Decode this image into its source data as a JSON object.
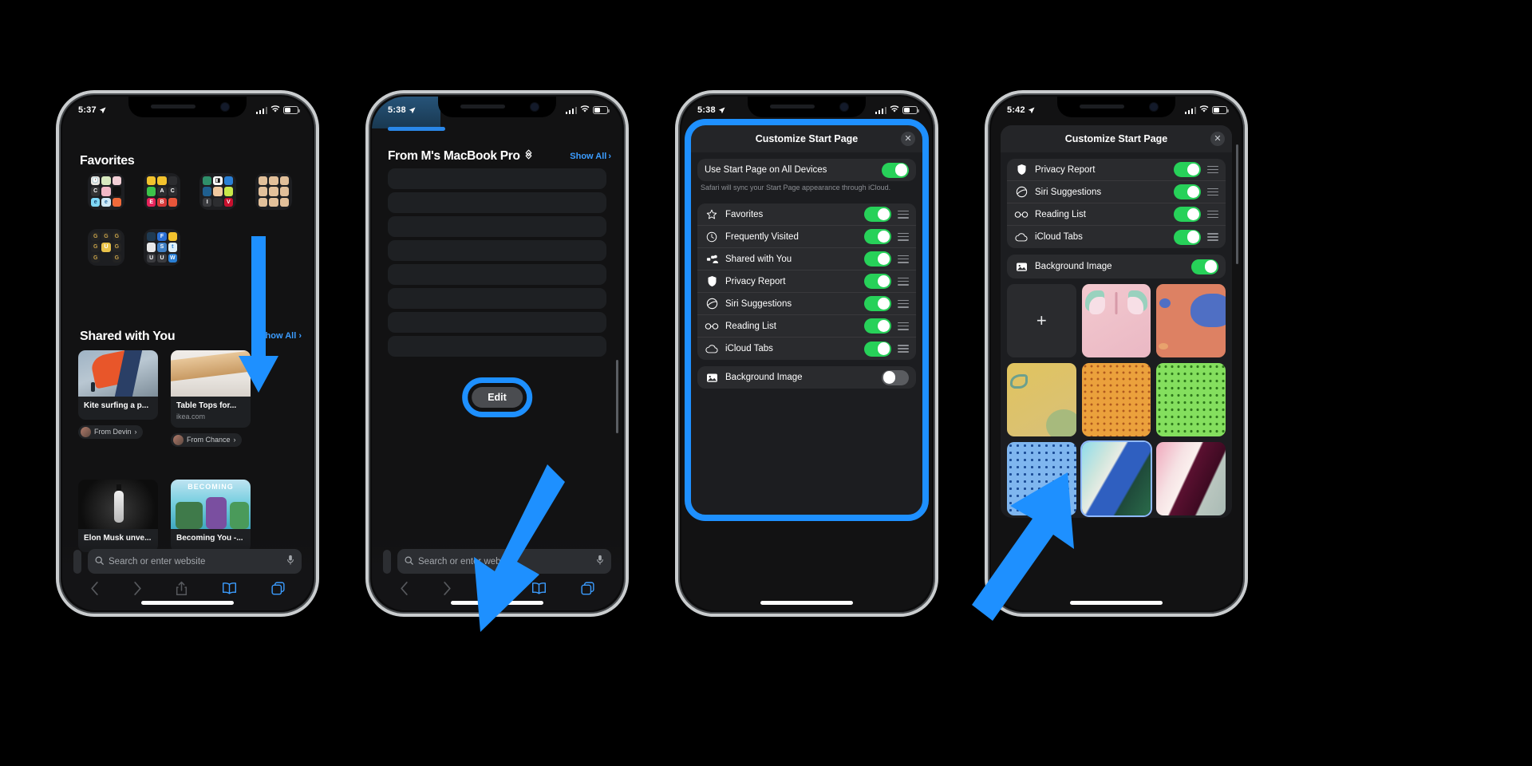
{
  "accent": "#1e90ff",
  "toggle_on_color": "#27d159",
  "phones": [
    {
      "id": "phone-1",
      "status": {
        "time": "5:37",
        "location_icon": "location-arrow-icon",
        "signal": "cellular-bars-icon",
        "wifi": "wifi-icon",
        "battery": "battery-icon"
      },
      "sections": {
        "favorites_title": "Favorites",
        "shared_title": "Shared with You",
        "show_all": "Show All"
      },
      "cards": [
        {
          "title": "Kite surfing a p...",
          "domain": "",
          "from": "From Devin"
        },
        {
          "title": "Table Tops for...",
          "domain": "ikea.com",
          "from": "From Chance"
        },
        {
          "title": "Elon Musk unve...",
          "domain": "",
          "from": ""
        },
        {
          "title": "Becoming You -...",
          "domain": "",
          "from": ""
        }
      ],
      "search_placeholder": "Search or enter website",
      "toolbar": [
        "back-icon",
        "forward-icon",
        "share-icon",
        "bookmarks-icon",
        "tabs-icon"
      ]
    },
    {
      "id": "phone-2",
      "status": {
        "time": "5:38"
      },
      "header_title": "From M's MacBook Pro",
      "show_all": "Show All",
      "edit_button": "Edit",
      "search_placeholder": "Search or enter website"
    },
    {
      "id": "phone-3",
      "status": {
        "time": "5:38"
      },
      "sheet_title": "Customize Start Page",
      "close_label": "✕",
      "sync_row": {
        "label": "Use Start Page on All Devices",
        "on": true
      },
      "sync_note": "Safari will sync your Start Page appearance through iCloud.",
      "items": [
        {
          "label": "Favorites",
          "icon": "star-icon",
          "on": true
        },
        {
          "label": "Frequently Visited",
          "icon": "clock-icon",
          "on": true
        },
        {
          "label": "Shared with You",
          "icon": "people-icon",
          "on": true
        },
        {
          "label": "Privacy Report",
          "icon": "shield-icon",
          "on": true
        },
        {
          "label": "Siri Suggestions",
          "icon": "siri-icon",
          "on": true
        },
        {
          "label": "Reading List",
          "icon": "glasses-icon",
          "on": true
        },
        {
          "label": "iCloud Tabs",
          "icon": "cloud-icon",
          "on": true
        }
      ],
      "background_row": {
        "label": "Background Image",
        "icon": "photo-icon",
        "on": false
      }
    },
    {
      "id": "phone-4",
      "status": {
        "time": "5:42"
      },
      "sheet_title": "Customize Start Page",
      "close_label": "✕",
      "items": [
        {
          "label": "Privacy Report",
          "icon": "shield-icon",
          "on": true
        },
        {
          "label": "Siri Suggestions",
          "icon": "siri-icon",
          "on": true
        },
        {
          "label": "Reading List",
          "icon": "glasses-icon",
          "on": true
        },
        {
          "label": "iCloud Tabs",
          "icon": "cloud-icon",
          "on": true
        }
      ],
      "background_row": {
        "label": "Background Image",
        "icon": "photo-icon",
        "on": true
      },
      "wallpapers": [
        {
          "name": "add-custom-image",
          "add": true,
          "label": "+"
        },
        {
          "name": "butterfly-pink",
          "selected": false
        },
        {
          "name": "bear-orange-blue",
          "selected": false
        },
        {
          "name": "wave-gold",
          "selected": false
        },
        {
          "name": "dots-orange",
          "selected": false
        },
        {
          "name": "dots-green",
          "selected": false
        },
        {
          "name": "dots-blue",
          "selected": false
        },
        {
          "name": "prism-blue",
          "selected": true
        },
        {
          "name": "prism-pink",
          "selected": false
        },
        {
          "name": "prism-orange",
          "selected": false
        }
      ]
    }
  ]
}
